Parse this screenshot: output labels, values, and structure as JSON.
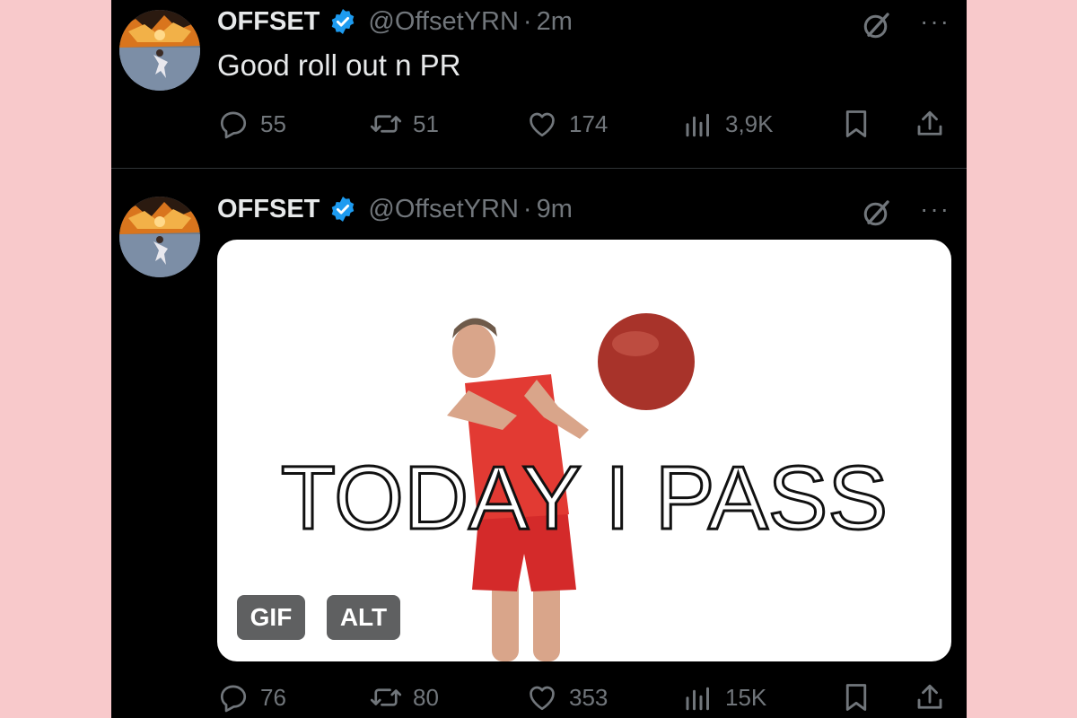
{
  "tweets": [
    {
      "display_name": "OFFSET",
      "handle": "@OffsetYRN",
      "separator": "·",
      "time": "2m",
      "text": "Good roll out n PR",
      "replies": "55",
      "reposts": "51",
      "likes": "174",
      "views": "3,9K"
    },
    {
      "display_name": "OFFSET",
      "handle": "@OffsetYRN",
      "separator": "·",
      "time": "9m",
      "media": {
        "caption": "TODAY I PASS",
        "gif_badge": "GIF",
        "alt_badge": "ALT"
      },
      "replies": "76",
      "reposts": "80",
      "likes": "353",
      "views": "15K"
    }
  ],
  "more_label": "···",
  "colors": {
    "background": "#000000",
    "page_margin": "#f8c9cb",
    "text_primary": "#e7e9ea",
    "text_secondary": "#71767b",
    "verified_blue": "#1d9bf0"
  },
  "icons": [
    "verified-badge-icon",
    "grok-icon",
    "more-icon",
    "reply-icon",
    "repost-icon",
    "like-icon",
    "views-icon",
    "bookmark-icon",
    "share-icon"
  ]
}
